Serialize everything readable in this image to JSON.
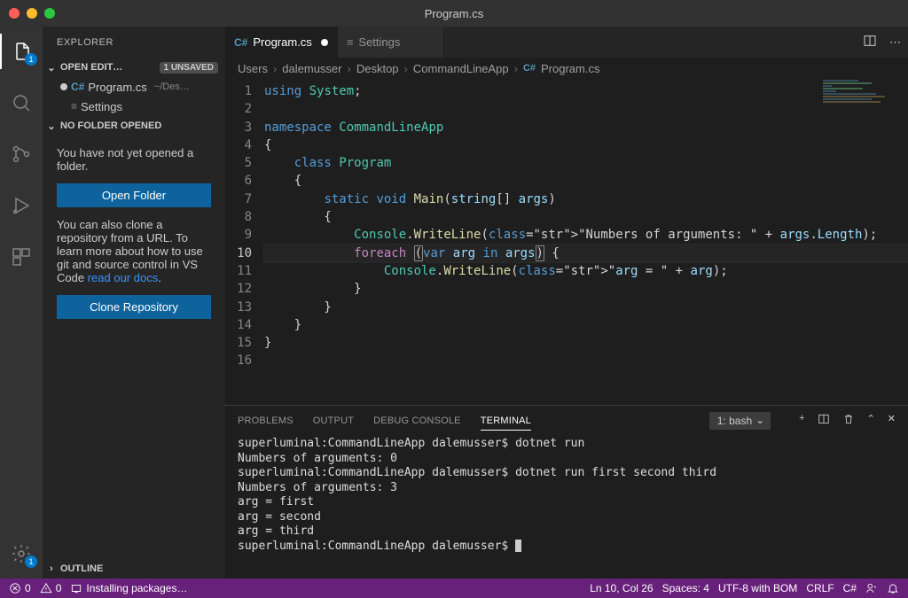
{
  "window": {
    "title": "Program.cs"
  },
  "activitybar": {
    "explorer_badge": "1",
    "settings_badge": "1"
  },
  "sidebar": {
    "title": "EXPLORER",
    "open_editors": {
      "title": "OPEN EDIT…",
      "unsaved": "1 UNSAVED",
      "items": [
        {
          "label": "Program.cs",
          "path": "~/Des…",
          "dirty": true,
          "icon": "csharp"
        },
        {
          "label": "Settings",
          "dirty": false,
          "icon": "settings"
        }
      ]
    },
    "no_folder": {
      "title": "NO FOLDER OPENED",
      "msg1": "You have not yet opened a folder.",
      "open_btn": "Open Folder",
      "msg2_a": "You can also clone a repository from a URL. To learn more about how to use git and source control in VS Code ",
      "msg2_link": "read our docs",
      "msg2_b": ".",
      "clone_btn": "Clone Repository"
    },
    "outline_title": "OUTLINE"
  },
  "tabs": [
    {
      "label": "Program.cs",
      "active": true,
      "icon": "csharp",
      "dirty": true
    },
    {
      "label": "Settings",
      "active": false,
      "icon": "settings",
      "dirty": false
    }
  ],
  "breadcrumb": [
    "Users",
    "dalemusser",
    "Desktop",
    "CommandLineApp",
    "Program.cs"
  ],
  "editor": {
    "lines": [
      "using System;",
      "",
      "namespace CommandLineApp",
      "{",
      "    class Program",
      "    {",
      "        static void Main(string[] args)",
      "        {",
      "            Console.WriteLine(\"Numbers of arguments: \" + args.Length);",
      "            foreach (var arg in args) {",
      "                Console.WriteLine(\"arg = \" + arg);",
      "            }",
      "        }",
      "    }",
      "}",
      ""
    ],
    "active_line": 10
  },
  "panel": {
    "tabs": [
      "PROBLEMS",
      "OUTPUT",
      "DEBUG CONSOLE",
      "TERMINAL"
    ],
    "active": "TERMINAL",
    "terminal_selector": "1: bash",
    "output": "superluminal:CommandLineApp dalemusser$ dotnet run\nNumbers of arguments: 0\nsuperluminal:CommandLineApp dalemusser$ dotnet run first second third\nNumbers of arguments: 3\narg = first\narg = second\narg = third\nsuperluminal:CommandLineApp dalemusser$ "
  },
  "statusbar": {
    "errors": "0",
    "warnings": "0",
    "installing": "Installing packages…",
    "ln_col": "Ln 10, Col 26",
    "spaces": "Spaces: 4",
    "encoding": "UTF-8 with BOM",
    "eol": "CRLF",
    "lang": "C#"
  }
}
